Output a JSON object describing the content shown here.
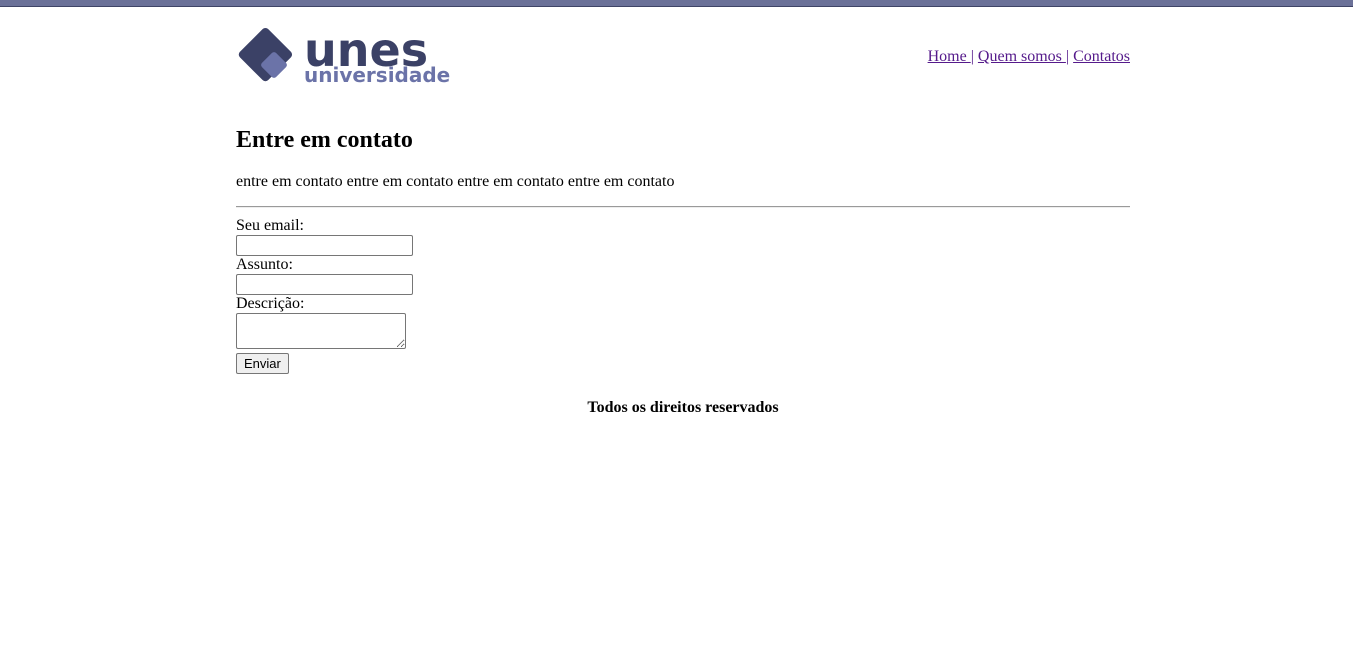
{
  "brand": {
    "name": "unes",
    "tagline": "universidade",
    "colors": {
      "dark": "#3b4166",
      "light": "#6b73a8",
      "topbar": "#6b7198"
    }
  },
  "nav": {
    "home": "Home ",
    "about": "Quem somos ",
    "contacts": "Contatos",
    "separator": "|"
  },
  "page": {
    "title": "Entre em contato",
    "intro": "entre em contato entre em contato entre em contato entre em contato"
  },
  "form": {
    "email_label": "Seu email:",
    "email_value": "",
    "subject_label": "Assunto:",
    "subject_value": "",
    "description_label": "Descrição:",
    "description_value": "",
    "submit_label": "Enviar"
  },
  "footer": {
    "text": "Todos os direitos reservados"
  }
}
